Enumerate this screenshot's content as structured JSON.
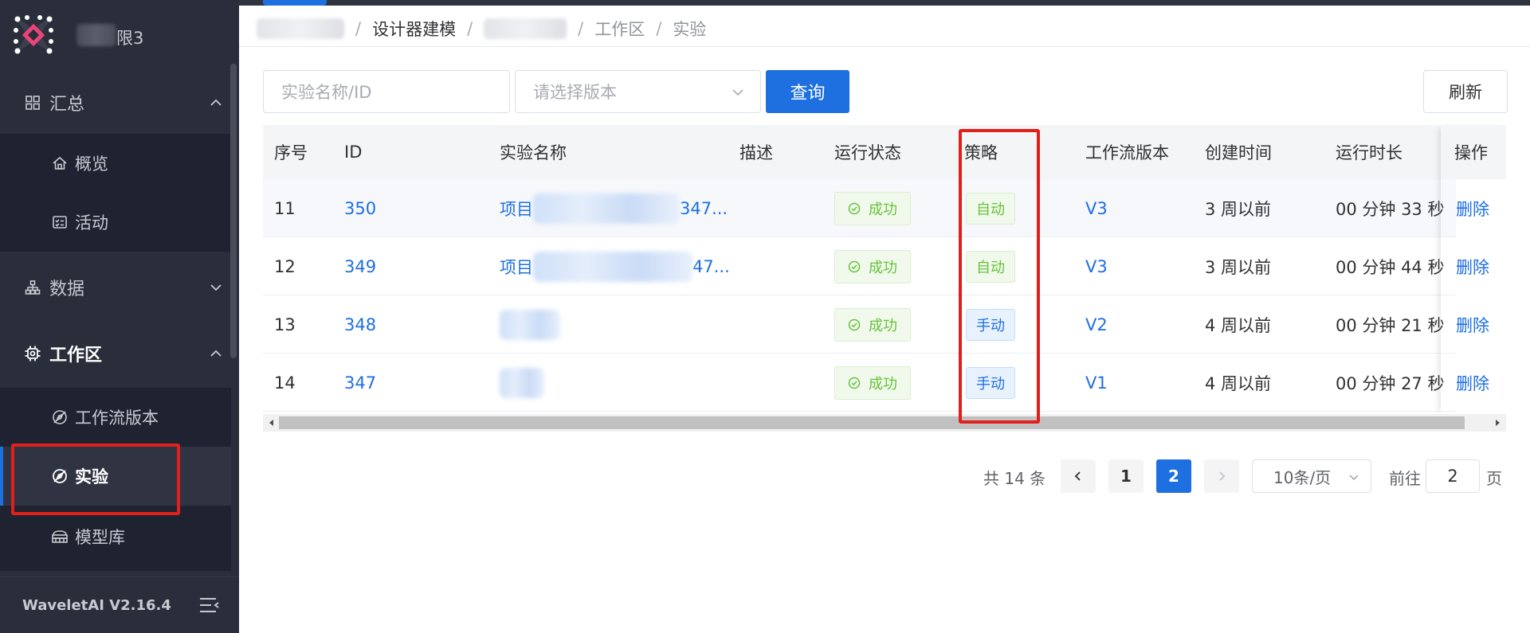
{
  "sidebar": {
    "brand_suffix": "限3",
    "groups": {
      "summary": {
        "label": "汇总"
      },
      "data": {
        "label": "数据"
      },
      "workspace": {
        "label": "工作区"
      }
    },
    "summary_items": [
      {
        "label": "概览",
        "icon": "home-icon"
      },
      {
        "label": "活动",
        "icon": "activity-icon"
      }
    ],
    "workspace_items": [
      {
        "label": "工作流版本",
        "icon": "compass-icon"
      },
      {
        "label": "实验",
        "icon": "compass-icon"
      },
      {
        "label": "模型库",
        "icon": "database-icon"
      }
    ],
    "version": "WaveletAI V2.16.4"
  },
  "breadcrumb": {
    "item2": "设计器建模",
    "item4": "工作区",
    "item5": "实验",
    "separator": "/"
  },
  "filters": {
    "name_placeholder": "实验名称/ID",
    "version_placeholder": "请选择版本",
    "search_label": "查询",
    "refresh_label": "刷新"
  },
  "table": {
    "headers": {
      "seq": "序号",
      "id": "ID",
      "name": "实验名称",
      "desc": "描述",
      "status": "运行状态",
      "strategy": "策略",
      "workflow_version": "工作流版本",
      "created": "创建时间",
      "duration": "运行时长",
      "op": "操作"
    },
    "rows": [
      {
        "seq": "11",
        "id": "350",
        "name_prefix": "项目",
        "name_suffix": "347...",
        "status": "成功",
        "strategy": "自动",
        "version": "V3",
        "created": "3 周以前",
        "duration": "00 分钟 33 秒",
        "op": "删除"
      },
      {
        "seq": "12",
        "id": "349",
        "name_prefix": "项目",
        "name_suffix": "47...",
        "status": "成功",
        "strategy": "自动",
        "version": "V3",
        "created": "3 周以前",
        "duration": "00 分钟 44 秒",
        "op": "删除"
      },
      {
        "seq": "13",
        "id": "348",
        "name_prefix": "",
        "name_suffix": "",
        "status": "成功",
        "strategy": "手动",
        "version": "V2",
        "created": "4 周以前",
        "duration": "00 分钟 21 秒",
        "op": "删除"
      },
      {
        "seq": "14",
        "id": "347",
        "name_prefix": "",
        "name_suffix": "",
        "status": "成功",
        "strategy": "手动",
        "version": "V1",
        "created": "4 周以前",
        "duration": "00 分钟 27 秒",
        "op": "删除"
      }
    ]
  },
  "pagination": {
    "total": "共 14 条",
    "pages": [
      "1",
      "2"
    ],
    "current": "2",
    "page_size": "10条/页",
    "goto_prefix": "前往",
    "goto_value": "2",
    "goto_suffix": "页"
  },
  "colors": {
    "primary": "#1e6fe0",
    "sidebar_bg": "#2a2d3a",
    "success": "#67c23a",
    "highlight_box": "#e0201c"
  }
}
